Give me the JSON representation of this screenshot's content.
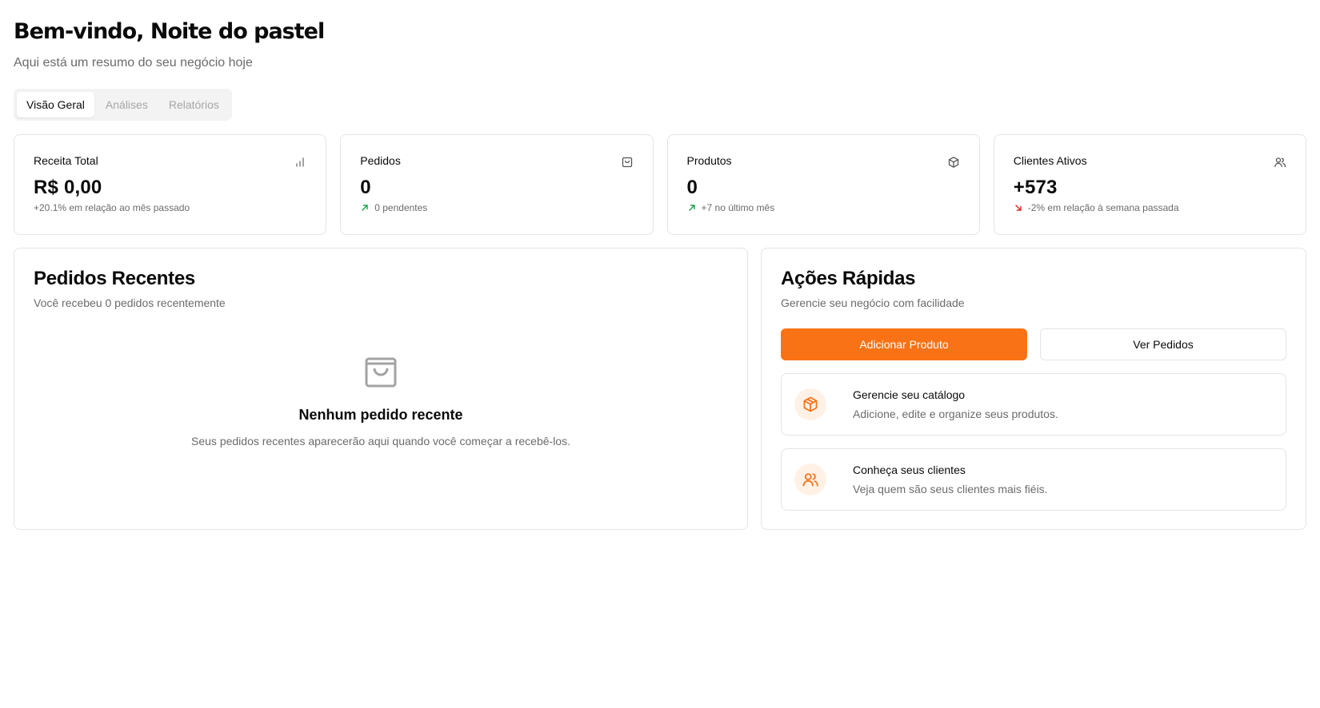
{
  "header": {
    "title": "Bem-vindo, Noite do pastel",
    "subtitle": "Aqui está um resumo do seu negócio hoje"
  },
  "tabs": [
    {
      "label": "Visão Geral",
      "active": true
    },
    {
      "label": "Análises",
      "active": false
    },
    {
      "label": "Relatórios",
      "active": false
    }
  ],
  "stats": [
    {
      "label": "Receita Total",
      "value": "R$ 0,00",
      "note": "+20.1% em relação ao mês passado",
      "icon": "bar-chart-icon",
      "trend": "none"
    },
    {
      "label": "Pedidos",
      "value": "0",
      "note": "0 pendentes",
      "icon": "shopping-bag-icon",
      "trend": "up"
    },
    {
      "label": "Produtos",
      "value": "0",
      "note": "+7 no último mês",
      "icon": "package-icon",
      "trend": "up"
    },
    {
      "label": "Clientes Ativos",
      "value": "+573",
      "note": "-2% em relação à semana passada",
      "icon": "users-icon",
      "trend": "down"
    }
  ],
  "recent_orders": {
    "title": "Pedidos Recentes",
    "subtitle": "Você recebeu 0 pedidos recentemente",
    "empty_icon": "shopping-bag-icon",
    "empty_title": "Nenhum pedido recente",
    "empty_text": "Seus pedidos recentes aparecerão aqui quando você começar a recebê-los."
  },
  "quick_actions": {
    "title": "Ações Rápidas",
    "subtitle": "Gerencie seu negócio com facilidade",
    "primary_button": "Adicionar Produto",
    "secondary_button": "Ver Pedidos",
    "cards": [
      {
        "title": "Gerencie seu catálogo",
        "desc": "Adicione, edite e organize seus produtos.",
        "icon": "package-icon"
      },
      {
        "title": "Conheça seus clientes",
        "desc": "Veja quem são seus clientes mais fiéis.",
        "icon": "users-icon"
      }
    ]
  },
  "colors": {
    "accent": "#f97316",
    "trend_up": "#16a34a",
    "trend_down": "#dc2626",
    "muted_text": "#6b6b6b",
    "border": "#e4e4e7"
  }
}
